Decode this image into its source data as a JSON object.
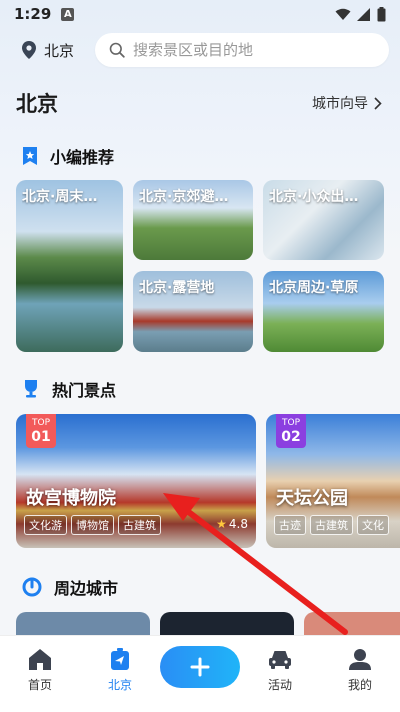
{
  "status": {
    "time": "1:29",
    "notif_letter": "A"
  },
  "top": {
    "location": "北京",
    "search_placeholder": "搜索景区或目的地"
  },
  "city": {
    "title": "北京",
    "guide_label": "城市向导"
  },
  "recommend": {
    "title": "小编推荐",
    "cards": [
      {
        "label": "北京·周末…"
      },
      {
        "label": "北京·京郊避…"
      },
      {
        "label": "北京·小众出…"
      },
      {
        "label": "北京·露营地"
      },
      {
        "label": "北京周边·草原"
      }
    ]
  },
  "hot": {
    "title": "热门景点",
    "cards": [
      {
        "badge_top": "TOP",
        "badge_rank": "01",
        "name": "故宫博物院",
        "tags": [
          "文化游",
          "博物馆",
          "古建筑"
        ],
        "rating": "4.8",
        "badge_color": "#f25a5a"
      },
      {
        "badge_top": "TOP",
        "badge_rank": "02",
        "name": "天坛公园",
        "tags": [
          "古迹",
          "古建筑",
          "文化"
        ],
        "badge_color": "#8b3fe0"
      }
    ]
  },
  "nearby": {
    "title": "周边城市"
  },
  "tabs": [
    {
      "label": "首页",
      "icon": "home-icon"
    },
    {
      "label": "北京",
      "icon": "location-arrow-icon",
      "active": true
    },
    {
      "label": "",
      "icon": "plus-icon"
    },
    {
      "label": "活动",
      "icon": "car-icon"
    },
    {
      "label": "我的",
      "icon": "user-icon"
    }
  ],
  "colors": {
    "accent": "#1e80f0",
    "annotation_arrow": "#e8201e"
  }
}
